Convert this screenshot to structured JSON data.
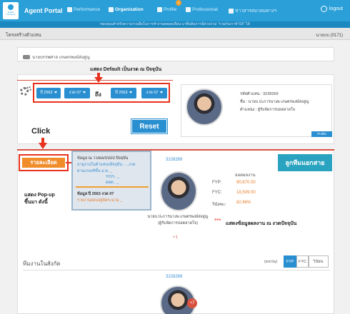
{
  "header": {
    "app_title": "Agent Portal",
    "logo_text": "thailife insurance",
    "nav": [
      {
        "label": "Performance"
      },
      {
        "label": "Organization"
      },
      {
        "label": "Profile"
      },
      {
        "label": "Professional"
      },
      {
        "label": "ข่าวสารสมาคมทางฯ"
      }
    ],
    "notification_count": "2",
    "logout_label": "logout"
  },
  "announcement": "ขอบคุณสำหรับความร่วมมือในการทำงานตลอดเดือน มายืนยันการมีส่วนร่วม \"รวมกันเราทำได้\" ได้",
  "subheader": {
    "title": "โครงสร้างตัวแทน",
    "right_text": "นายบบ (0171)"
  },
  "breadcrumb": "นายบรรพศาล เกษตรพงษ์ส่งสูญ",
  "annotations": {
    "default_note": "แสดง Default เป็นงวด ณ ปัจจุบัน",
    "click_note": "Click",
    "popup_note_line1": "แสดง Pop-up",
    "popup_note_line2": "ขึ้นมา ดังนี้",
    "perf_stars": "***",
    "perf_note": "แสดงข้อมูลผลงาน ณ งวดปัจจุบัน"
  },
  "filters": {
    "from_year": "ปี 2563",
    "from_period": "งวด 07",
    "to_label": "ถึง",
    "to_year": "ปี 2563",
    "to_period": "งวด 07"
  },
  "reset_label": "Reset",
  "profile_card": {
    "code": "รหัสตัวแทน : 3228269",
    "name": "ชื่อ : นายบ.ปะการนางพ เกษตรพงษ์ส่งสูญ",
    "position": "ตำแหน่ง : ผู้รับจัดการบ่อตลาดใจ",
    "tab_label": "Profile"
  },
  "detail_button": "รายละเอียด",
  "popup": {
    "line1": "ข้อมูล ณ วว/ดด/ปปปป ปัจจุบัน",
    "line2": "อายุงานในตำแหน่งปัจจุบัน : ...งวด",
    "line3": "ผ่านเกณฑ์ขั้น ม.พ. _",
    "line4": "รรรร.. _",
    "line5": "ตตต.. _",
    "line6": "ข้อมูล ปี 2563 งวด 07",
    "line7": "รายงานสอบอยู่จัดระนาม _"
  },
  "team_button": "ลูกทีมแยกสาย",
  "center_agent": {
    "code": "3228269",
    "name": "นายบ.ปะการนางพ เกษตรพงษ์ส่งสูญ",
    "position": "(ผู้รับจัดการบ่อตลาดใจ)",
    "plus": "+1"
  },
  "stats": {
    "header": "ยอดผลงาน",
    "fyp_label": "FYP:",
    "fyp_value": "90,670.00",
    "fyc_label": "FYC:",
    "fyc_value": "18,509.00",
    "rate_label": "วินัยพะ:",
    "rate_value": "82.66%"
  },
  "team_section": {
    "title": "ทีมงานในสังกัด",
    "sort_label": "(sort by)",
    "sort_options": [
      "FYP",
      "FYC",
      "วินัยพ."
    ],
    "sub_code": "3228269",
    "sub_plus": "+7"
  }
}
